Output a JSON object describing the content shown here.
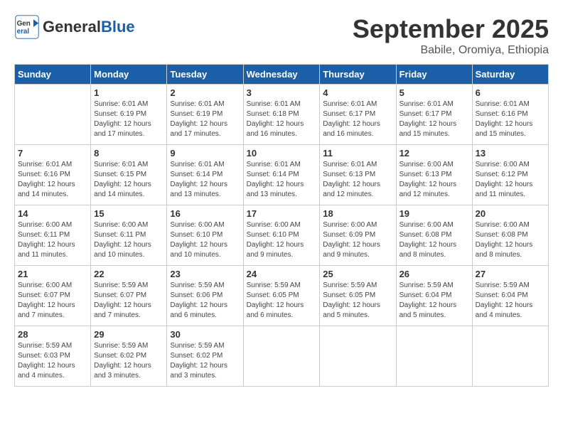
{
  "header": {
    "logo_general": "General",
    "logo_blue": "Blue",
    "month_title": "September 2025",
    "location": "Babile, Oromiya, Ethiopia"
  },
  "calendar": {
    "days_of_week": [
      "Sunday",
      "Monday",
      "Tuesday",
      "Wednesday",
      "Thursday",
      "Friday",
      "Saturday"
    ],
    "weeks": [
      [
        {
          "day": "",
          "info": ""
        },
        {
          "day": "1",
          "info": "Sunrise: 6:01 AM\nSunset: 6:19 PM\nDaylight: 12 hours\nand 17 minutes."
        },
        {
          "day": "2",
          "info": "Sunrise: 6:01 AM\nSunset: 6:19 PM\nDaylight: 12 hours\nand 17 minutes."
        },
        {
          "day": "3",
          "info": "Sunrise: 6:01 AM\nSunset: 6:18 PM\nDaylight: 12 hours\nand 16 minutes."
        },
        {
          "day": "4",
          "info": "Sunrise: 6:01 AM\nSunset: 6:17 PM\nDaylight: 12 hours\nand 16 minutes."
        },
        {
          "day": "5",
          "info": "Sunrise: 6:01 AM\nSunset: 6:17 PM\nDaylight: 12 hours\nand 15 minutes."
        },
        {
          "day": "6",
          "info": "Sunrise: 6:01 AM\nSunset: 6:16 PM\nDaylight: 12 hours\nand 15 minutes."
        }
      ],
      [
        {
          "day": "7",
          "info": "Sunrise: 6:01 AM\nSunset: 6:16 PM\nDaylight: 12 hours\nand 14 minutes."
        },
        {
          "day": "8",
          "info": "Sunrise: 6:01 AM\nSunset: 6:15 PM\nDaylight: 12 hours\nand 14 minutes."
        },
        {
          "day": "9",
          "info": "Sunrise: 6:01 AM\nSunset: 6:14 PM\nDaylight: 12 hours\nand 13 minutes."
        },
        {
          "day": "10",
          "info": "Sunrise: 6:01 AM\nSunset: 6:14 PM\nDaylight: 12 hours\nand 13 minutes."
        },
        {
          "day": "11",
          "info": "Sunrise: 6:01 AM\nSunset: 6:13 PM\nDaylight: 12 hours\nand 12 minutes."
        },
        {
          "day": "12",
          "info": "Sunrise: 6:00 AM\nSunset: 6:13 PM\nDaylight: 12 hours\nand 12 minutes."
        },
        {
          "day": "13",
          "info": "Sunrise: 6:00 AM\nSunset: 6:12 PM\nDaylight: 12 hours\nand 11 minutes."
        }
      ],
      [
        {
          "day": "14",
          "info": "Sunrise: 6:00 AM\nSunset: 6:11 PM\nDaylight: 12 hours\nand 11 minutes."
        },
        {
          "day": "15",
          "info": "Sunrise: 6:00 AM\nSunset: 6:11 PM\nDaylight: 12 hours\nand 10 minutes."
        },
        {
          "day": "16",
          "info": "Sunrise: 6:00 AM\nSunset: 6:10 PM\nDaylight: 12 hours\nand 10 minutes."
        },
        {
          "day": "17",
          "info": "Sunrise: 6:00 AM\nSunset: 6:10 PM\nDaylight: 12 hours\nand 9 minutes."
        },
        {
          "day": "18",
          "info": "Sunrise: 6:00 AM\nSunset: 6:09 PM\nDaylight: 12 hours\nand 9 minutes."
        },
        {
          "day": "19",
          "info": "Sunrise: 6:00 AM\nSunset: 6:08 PM\nDaylight: 12 hours\nand 8 minutes."
        },
        {
          "day": "20",
          "info": "Sunrise: 6:00 AM\nSunset: 6:08 PM\nDaylight: 12 hours\nand 8 minutes."
        }
      ],
      [
        {
          "day": "21",
          "info": "Sunrise: 6:00 AM\nSunset: 6:07 PM\nDaylight: 12 hours\nand 7 minutes."
        },
        {
          "day": "22",
          "info": "Sunrise: 5:59 AM\nSunset: 6:07 PM\nDaylight: 12 hours\nand 7 minutes."
        },
        {
          "day": "23",
          "info": "Sunrise: 5:59 AM\nSunset: 6:06 PM\nDaylight: 12 hours\nand 6 minutes."
        },
        {
          "day": "24",
          "info": "Sunrise: 5:59 AM\nSunset: 6:05 PM\nDaylight: 12 hours\nand 6 minutes."
        },
        {
          "day": "25",
          "info": "Sunrise: 5:59 AM\nSunset: 6:05 PM\nDaylight: 12 hours\nand 5 minutes."
        },
        {
          "day": "26",
          "info": "Sunrise: 5:59 AM\nSunset: 6:04 PM\nDaylight: 12 hours\nand 5 minutes."
        },
        {
          "day": "27",
          "info": "Sunrise: 5:59 AM\nSunset: 6:04 PM\nDaylight: 12 hours\nand 4 minutes."
        }
      ],
      [
        {
          "day": "28",
          "info": "Sunrise: 5:59 AM\nSunset: 6:03 PM\nDaylight: 12 hours\nand 4 minutes."
        },
        {
          "day": "29",
          "info": "Sunrise: 5:59 AM\nSunset: 6:02 PM\nDaylight: 12 hours\nand 3 minutes."
        },
        {
          "day": "30",
          "info": "Sunrise: 5:59 AM\nSunset: 6:02 PM\nDaylight: 12 hours\nand 3 minutes."
        },
        {
          "day": "",
          "info": ""
        },
        {
          "day": "",
          "info": ""
        },
        {
          "day": "",
          "info": ""
        },
        {
          "day": "",
          "info": ""
        }
      ]
    ]
  }
}
